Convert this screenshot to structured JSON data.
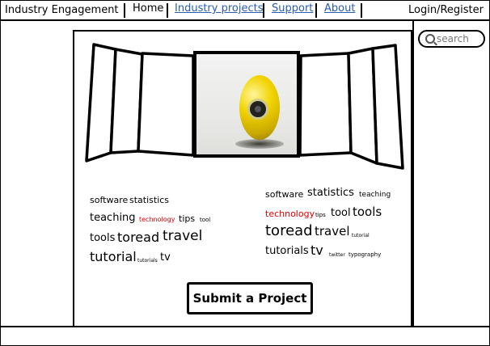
{
  "header": {
    "site_title": "Industry Engagement",
    "nav": [
      {
        "label": "Home"
      },
      {
        "label": "Industry projects"
      },
      {
        "label": "Support"
      },
      {
        "label": "About"
      }
    ],
    "login_label": "Login/Register"
  },
  "search": {
    "placeholder": "search"
  },
  "tag_cloud_left": [
    {
      "text": "software",
      "size": "small",
      "color": "#000000"
    },
    {
      "text": "statistics",
      "size": "small",
      "color": "#000000"
    },
    {
      "text": "teaching",
      "size": "medium",
      "color": "#000000"
    },
    {
      "text": "technology",
      "size": "tiny",
      "color": "#e00000"
    },
    {
      "text": "tips",
      "size": "small",
      "color": "#000000"
    },
    {
      "text": "tool",
      "size": "tiny",
      "color": "#000000"
    },
    {
      "text": "tools",
      "size": "medium",
      "color": "#000000"
    },
    {
      "text": "toread",
      "size": "large",
      "color": "#000000"
    },
    {
      "text": "travel",
      "size": "large",
      "color": "#000000"
    },
    {
      "text": "tutorial",
      "size": "large",
      "color": "#000000"
    },
    {
      "text": "tutorials",
      "size": "micro",
      "color": "#000000"
    },
    {
      "text": "tv",
      "size": "medium",
      "color": "#000000"
    }
  ],
  "tag_cloud_right": [
    {
      "text": "software",
      "size": "small",
      "color": "#000000"
    },
    {
      "text": "statistics",
      "size": "medium",
      "color": "#000000"
    },
    {
      "text": "teaching",
      "size": "tiny",
      "color": "#000000"
    },
    {
      "text": "technology",
      "size": "small",
      "color": "#e00000"
    },
    {
      "text": "tips",
      "size": "micro",
      "color": "#000000"
    },
    {
      "text": "tool",
      "size": "medium",
      "color": "#000000"
    },
    {
      "text": "tools",
      "size": "large",
      "color": "#000000"
    },
    {
      "text": "toread",
      "size": "xlarge",
      "color": "#000000"
    },
    {
      "text": "travel",
      "size": "large",
      "color": "#000000"
    },
    {
      "text": "tutorial",
      "size": "micro",
      "color": "#000000"
    },
    {
      "text": "tutorials",
      "size": "medium",
      "color": "#000000"
    },
    {
      "text": "tv",
      "size": "large",
      "color": "#000000"
    },
    {
      "text": "twitter",
      "size": "micro",
      "color": "#000000"
    },
    {
      "text": "typography",
      "size": "micro",
      "color": "#000000"
    }
  ],
  "submit_label": "Submit a Project",
  "carousel": {
    "image_subject": "yellow-robot-ball"
  }
}
